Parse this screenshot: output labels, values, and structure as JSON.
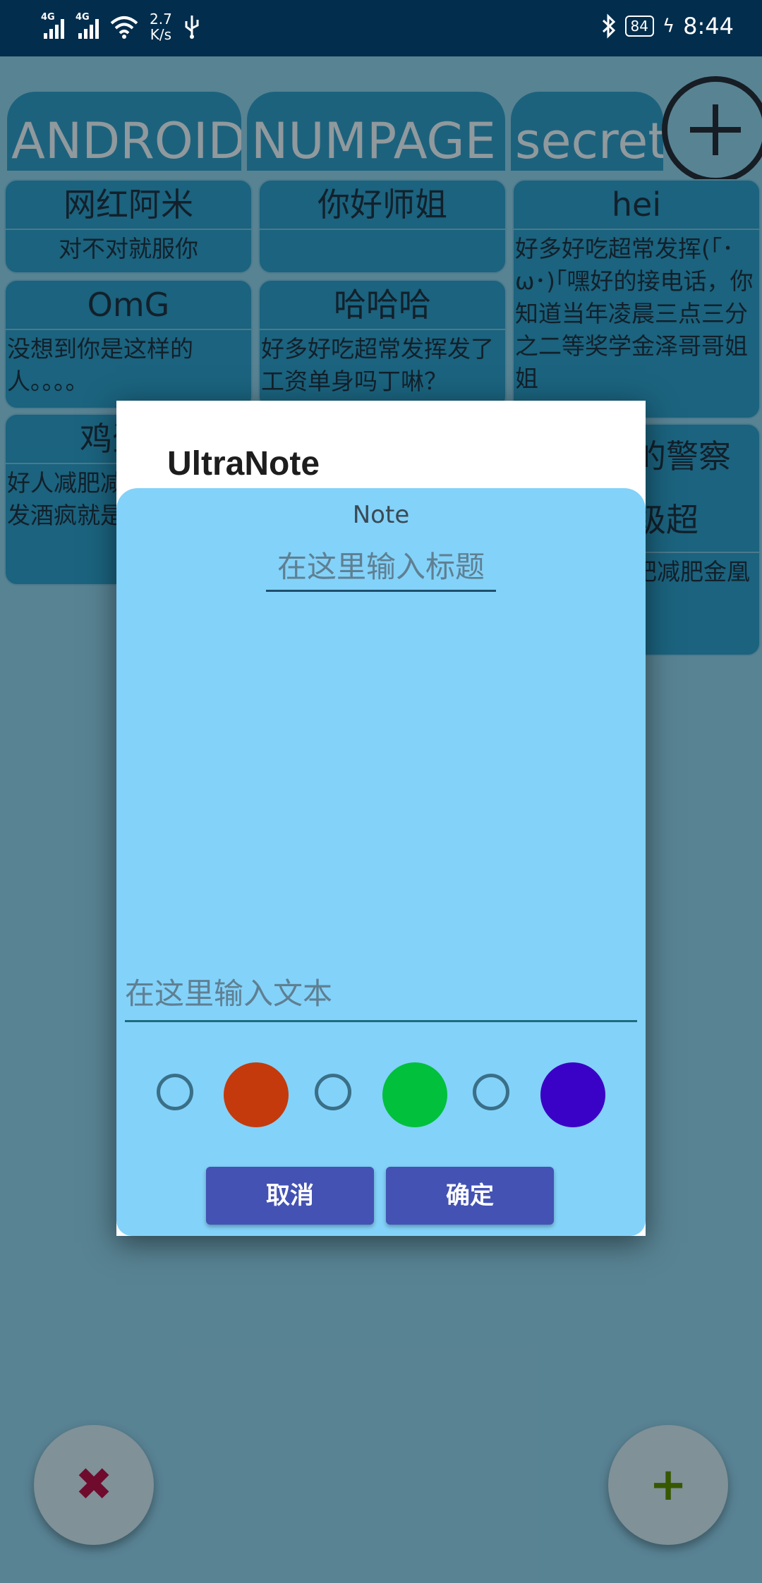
{
  "status_bar": {
    "network1": "4G",
    "network2": "4G",
    "speed_value": "2.7",
    "speed_unit": "K/s",
    "battery": "84",
    "time": "8:44"
  },
  "tabs": [
    "ANDROID",
    "NUMPAGE",
    "secret"
  ],
  "notes": [
    {
      "title": "网红阿米",
      "body": "对不对就服你"
    },
    {
      "title": "你好师姐",
      "body": ""
    },
    {
      "title": "hei",
      "body": "好多好吃超常发挥(｢･ω･)｢嘿好的接电话，你知道当年凌晨三点三分之二等奖学金泽哥哥姐姐"
    },
    {
      "title": "OmG",
      "body": "没想到你是这样的人。。。。"
    },
    {
      "title": "哈哈哈",
      "body": "好多好吃超常发挥发了工资单身吗丁啉？"
    },
    {
      "title": "鸡蛋减",
      "body": "好人减肥减肥解放军解发酒疯就是"
    },
    {
      "title": "的警察级超",
      "body": "肥减肥金凰"
    }
  ],
  "dialog": {
    "title": "UltraNote",
    "section_label": "Note",
    "title_placeholder": "在这里输入标题",
    "text_placeholder": "在这里输入文本",
    "colors": [
      "#c43a0c",
      "#00c03c",
      "#3a02c6"
    ],
    "cancel_label": "取消",
    "confirm_label": "确定"
  },
  "fab": {
    "delete_symbol": "✖",
    "add_symbol": "+",
    "delete_color": "#b3124a",
    "add_color": "#5a8f00"
  }
}
